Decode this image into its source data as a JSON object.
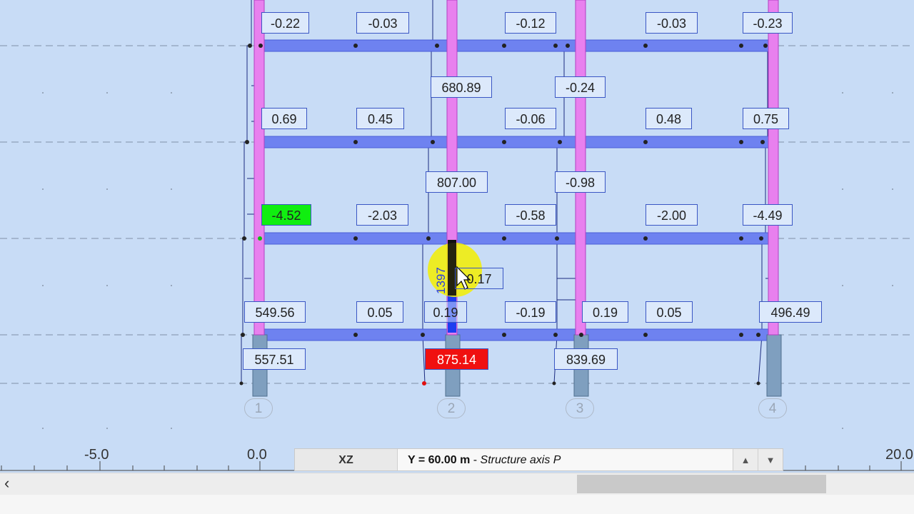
{
  "labels": {
    "l1": "-0.22",
    "l2": "-0.03",
    "l3": "-0.12",
    "l4": "-0.03",
    "l5": "-0.23",
    "l6": "680.89",
    "l7": "-0.24",
    "l8": "0.69",
    "l9": "0.45",
    "l10": "-0.06",
    "l11": "0.48",
    "l12": "0.75",
    "l13": "807.00",
    "l14": "-0.98",
    "l15": "-4.52",
    "l16": "-2.03",
    "l17": "-0.58",
    "l18": "-2.00",
    "l19": "-4.49",
    "l20": "0.17",
    "l20_vertical": "1397",
    "l21": "549.56",
    "l22": "0.05",
    "l23": "0.19",
    "l24": "-0.19",
    "l25": "0.19",
    "l26": "0.05",
    "l27": "496.49",
    "l28": "557.51",
    "l29": "875.14",
    "l30": "839.69"
  },
  "axes": {
    "a1": "1",
    "a2": "2",
    "a3": "3",
    "a4": "4"
  },
  "ruler": {
    "t1": "-5.0",
    "t2": "0.0",
    "t3": "20.0"
  },
  "viewbar": {
    "plane": "XZ",
    "position_bold": "Y = 60.00 m",
    "position_sep": " - ",
    "position_italic": "Structure axis P",
    "up_icon": "▲",
    "down_icon": "▼"
  },
  "scrollbar": {
    "left_icon": "‹"
  },
  "colors": {
    "background": "#c8dcf6",
    "beam": "#6e82f0",
    "column": "#e880ee",
    "footing": "#7f9fbf",
    "highlight_max": "#10ee10",
    "highlight_min": "#f01010",
    "cursor_halo": "#f3ef00"
  }
}
